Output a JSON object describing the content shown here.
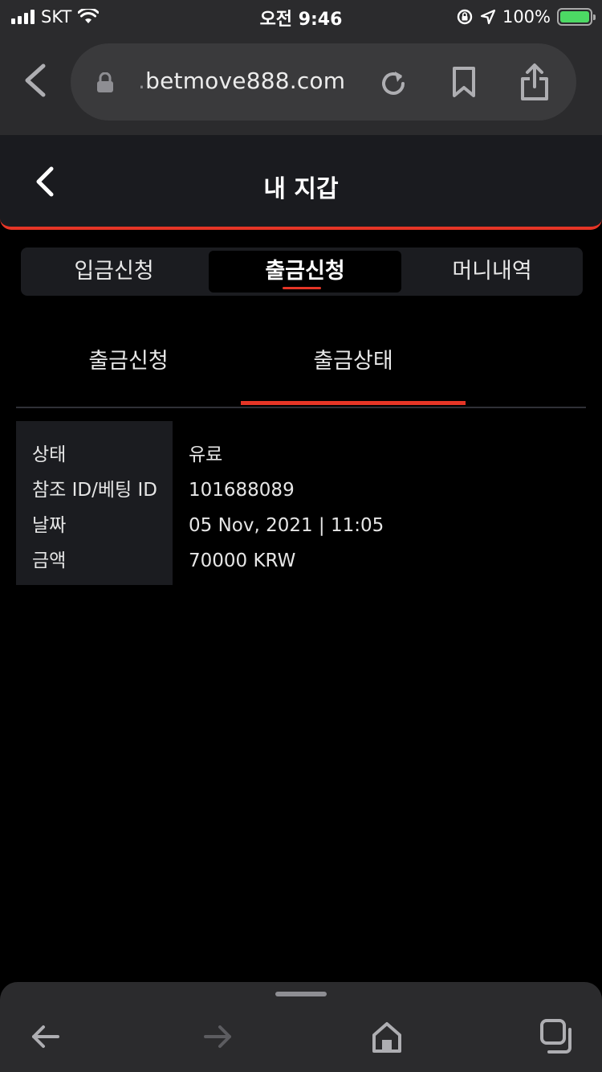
{
  "status_bar": {
    "carrier": "SKT",
    "time": "오전 9:46",
    "battery": "100%"
  },
  "browser": {
    "url_prefix": ".",
    "url_domain": "betmove888.com"
  },
  "header": {
    "title": "내 지갑"
  },
  "main_tabs": [
    {
      "label": "입금신청"
    },
    {
      "label": "출금신청",
      "active": true
    },
    {
      "label": "머니내역"
    }
  ],
  "sub_tabs": [
    {
      "label": "출금신청"
    },
    {
      "label": "출금상태",
      "active": true
    }
  ],
  "details": [
    {
      "label": "상태",
      "value": "유료"
    },
    {
      "label": "참조 ID/베팅 ID",
      "value": "101688089"
    },
    {
      "label": "날짜",
      "value": "05 Nov, 2021 | 11:05"
    },
    {
      "label": "금액",
      "value": "70000 KRW"
    }
  ],
  "colors": {
    "accent": "#e53526",
    "background": "#000000",
    "panel": "#1b1c20",
    "browser_chrome": "#2b2b2d"
  }
}
